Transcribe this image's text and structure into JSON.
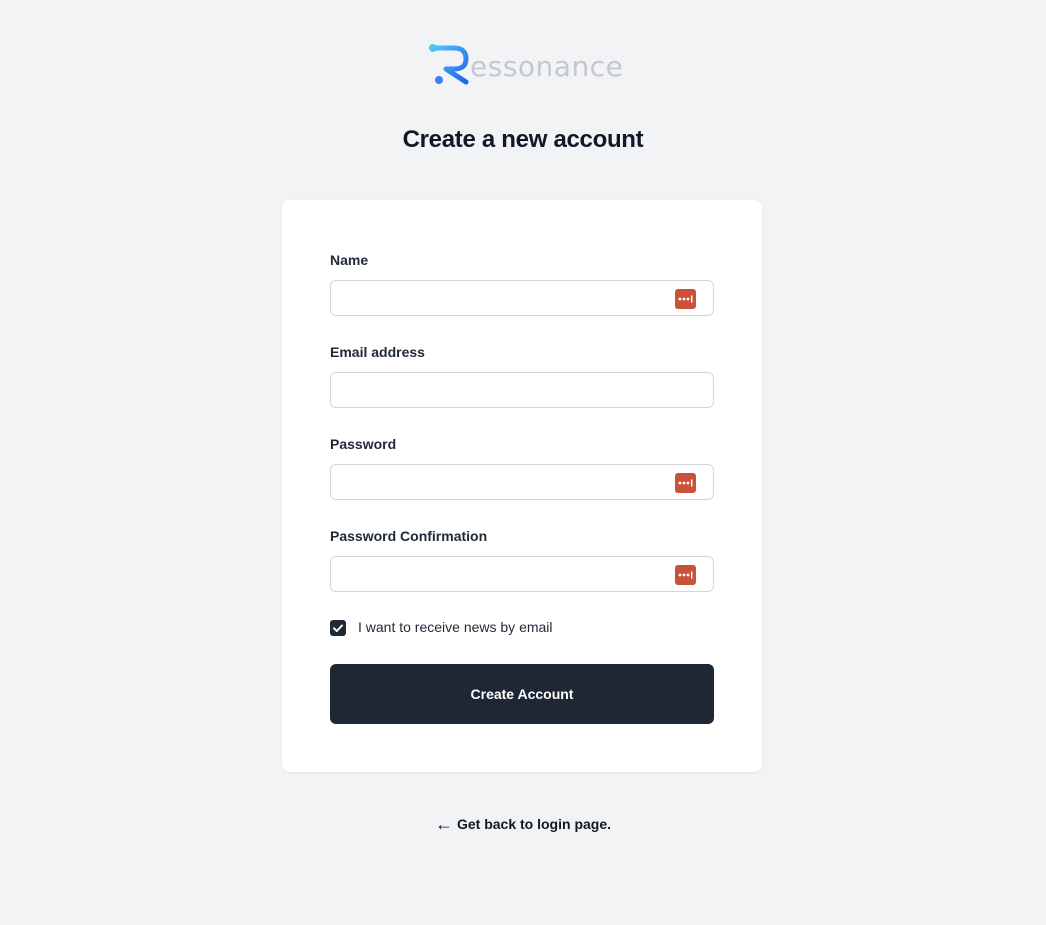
{
  "brand": {
    "name_rest": "essonance",
    "icon": "r-logo-icon",
    "logo_gradient": [
      "#4fc3f7",
      "#2563eb"
    ]
  },
  "page": {
    "title": "Create a new account"
  },
  "form": {
    "name_label": "Name",
    "name_value": "",
    "email_label": "Email address",
    "email_value": "",
    "password_label": "Password",
    "password_value": "",
    "password_confirmation_label": "Password Confirmation",
    "password_confirmation_value": "",
    "password_manager_icon": "password-manager-icon",
    "password_manager_color": "#c9523a",
    "newsletter_label": "I want to receive news by email",
    "newsletter_checked": true,
    "submit_label": "Create Account"
  },
  "footer": {
    "back_arrow": "←",
    "back_link_label": "Get back to login page."
  },
  "colors": {
    "background": "#f2f3f5",
    "card": "#ffffff",
    "button": "#1f2735"
  }
}
